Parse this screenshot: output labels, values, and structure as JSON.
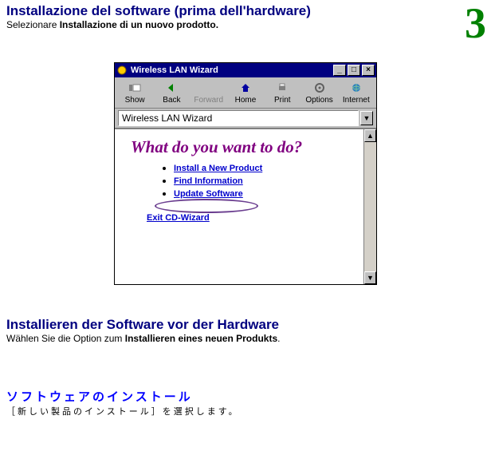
{
  "page_number": "3",
  "section_it": {
    "heading": "Installazione del software (prima dell'hardware)",
    "sub_prefix": "Selezionare ",
    "sub_bold": "Installazione di un nuovo prodotto."
  },
  "screenshot": {
    "window_title": "Wireless LAN Wizard",
    "toolbar": {
      "show": "Show",
      "back": "Back",
      "forward": "Forward",
      "home": "Home",
      "print": "Print",
      "options": "Options",
      "internet": "Internet"
    },
    "address": "Wireless LAN Wizard",
    "question": "What do you want to do?",
    "options": {
      "install": "Install a New Product",
      "find": "Find Information",
      "update": "Update Software"
    },
    "exit": "Exit CD-Wizard",
    "win_buttons": {
      "min": "_",
      "max": "□",
      "close": "×"
    }
  },
  "section_de": {
    "heading": "Installieren der Software vor der Hardware",
    "sub_prefix": "Wählen Sie die Option zum ",
    "sub_bold": "Installieren eines neuen Produkts",
    "sub_suffix": "."
  },
  "section_jp": {
    "heading": "ソフトウェアのインストール",
    "sub": "［新しい製品のインストール］を選択します。"
  }
}
